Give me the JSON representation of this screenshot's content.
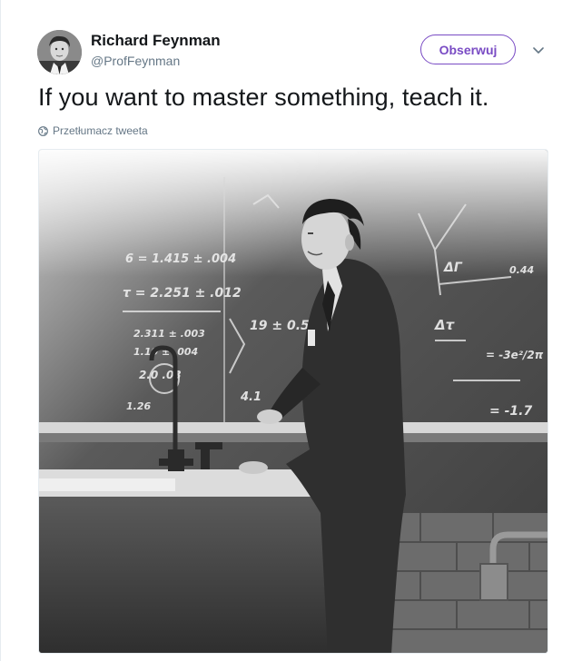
{
  "tweet": {
    "author_name": "Richard Feynman",
    "author_handle": "@ProfFeynman",
    "follow_label": "Obserwuj",
    "text": "If you want to master something, teach it.",
    "translate_label": "Przetłumacz tweeta"
  },
  "photo": {
    "board_text": [
      "6 = 1.415 ± .004",
      "τ = 2.251 ± .012",
      "2.311 ± .003",
      "1.19 ± .004",
      "2.0 .03",
      "1.26",
      "19 ± 0.5",
      "4.1",
      "ΔΓ",
      "0.44",
      "Δτ",
      "= -3e²/2π",
      "= -1.7"
    ]
  },
  "colors": {
    "accent": "#794bc4",
    "text": "#14171a",
    "secondary": "#657786"
  }
}
